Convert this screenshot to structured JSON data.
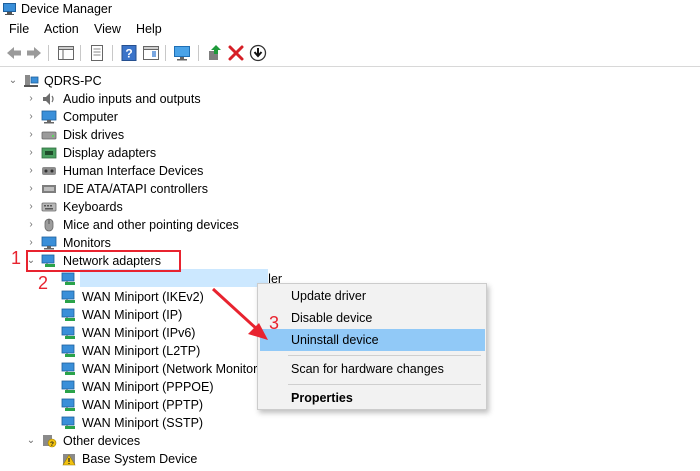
{
  "window": {
    "title": "Device Manager"
  },
  "menu": [
    "File",
    "Action",
    "View",
    "Help"
  ],
  "toolbar": {
    "icons": [
      "back-icon",
      "forward-icon",
      "properties-icon",
      "show-hide-console-tree-icon",
      "help-icon",
      "action-pane-icon",
      "monitor-icon",
      "update-driver-icon",
      "uninstall-icon",
      "download-icon"
    ]
  },
  "tree": {
    "root": "QDRS-PC",
    "categories": [
      "Audio inputs and outputs",
      "Computer",
      "Disk drives",
      "Display adapters",
      "Human Interface Devices",
      "IDE ATA/ATAPI controllers",
      "Keyboards",
      "Mice and other pointing devices",
      "Monitors",
      "Network adapters"
    ],
    "network_adapters": [
      "Realtek PCIe GbE Family Controller",
      "WAN Miniport (IKEv2)",
      "WAN Miniport (IP)",
      "WAN Miniport (IPv6)",
      "WAN Miniport (L2TP)",
      "WAN Miniport (Network Monitor)",
      "WAN Miniport (PPPOE)",
      "WAN Miniport (PPTP)",
      "WAN Miniport (SSTP)"
    ],
    "other_devices": "Other devices",
    "other_devices_children": [
      "Base System Device"
    ]
  },
  "context_menu": {
    "items": [
      "Update driver",
      "Disable device",
      "Uninstall device",
      "Scan for hardware changes",
      "Properties"
    ],
    "highlighted": "Uninstall device"
  },
  "annotations": {
    "step1": "1",
    "step2": "2",
    "step3": "3",
    "color": "#e8232f"
  },
  "colors": {
    "selection": "#cce8ff",
    "menu_highlight": "#91c9f7"
  }
}
